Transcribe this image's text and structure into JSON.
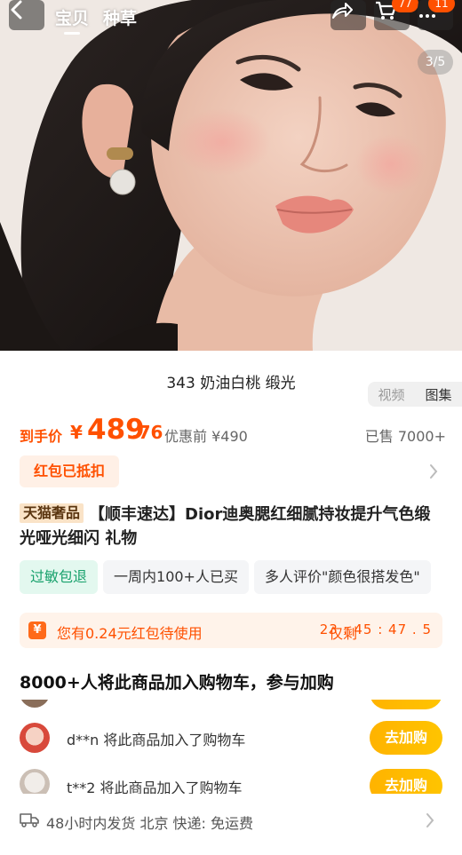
{
  "header": {
    "tabs": [
      "宝贝",
      "种草"
    ],
    "cart_badge": "77",
    "more_badge": "11",
    "pager": "3/5"
  },
  "variant": {
    "name": "343  奶油白桃 缎光"
  },
  "media_switch": {
    "video": "视频",
    "gallery": "图集"
  },
  "price": {
    "label": "到手价",
    "symbol": "¥",
    "integer": "489",
    "decimal": ".76",
    "pre_price": "优惠前 ¥490",
    "sold": "已售 7000+"
  },
  "coupon": {
    "label": "红包已抵扣"
  },
  "title": {
    "brand_tag": "天猫奢品",
    "text": "【顺丰速达】Dior迪奥腮红细腻持妆提升气色缎光哑光细闪 礼物"
  },
  "tags": [
    "过敏包退",
    "一周内100+人已买",
    "多人评价\"颜色很搭发色\""
  ],
  "red_packet": {
    "icon": "¥",
    "text": "您有0.24元红包待使用",
    "timer_label": "仅剩",
    "timer": "23 : 45 : 47 . 5"
  },
  "cart_activity": {
    "heading": "8000+人将此商品加入购物车，参与加购",
    "items": [
      {
        "text": "d**n 将此商品加入了购物车",
        "button": "去加购"
      },
      {
        "text": "t**2 将此商品加入了购物车",
        "button": "去加购"
      }
    ]
  },
  "shipping": {
    "text": "48小时内发货  北京  快递:  免运费"
  },
  "colors": {
    "accent": "#ff5000",
    "button": "#ffb800",
    "green": "#18a16c"
  },
  "icons": [
    "back-icon",
    "share-icon",
    "cart-icon",
    "truck-icon",
    "chevron-right-icon"
  ]
}
